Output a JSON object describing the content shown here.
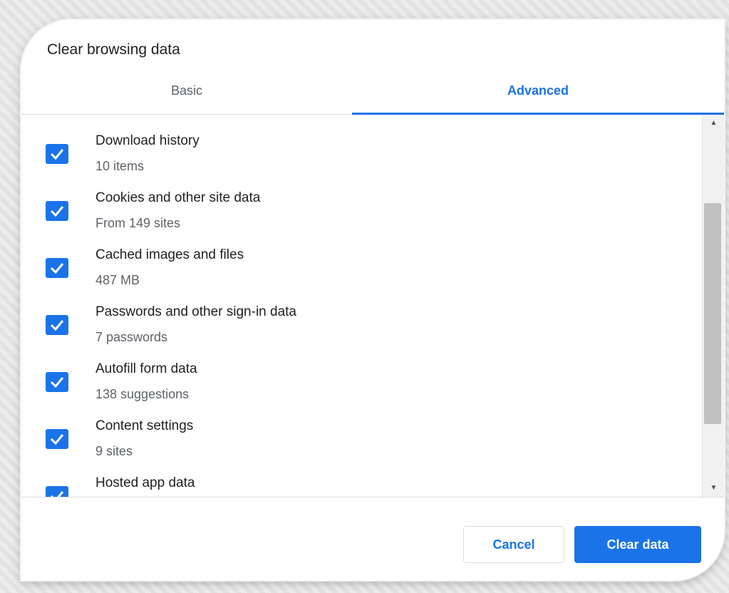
{
  "dialog": {
    "title": "Clear browsing data",
    "tabs": [
      {
        "label": "Basic",
        "selected": false
      },
      {
        "label": "Advanced",
        "selected": true
      }
    ],
    "items": [
      {
        "label": "Download history",
        "detail": "10 items",
        "checked": true
      },
      {
        "label": "Cookies and other site data",
        "detail": "From 149 sites",
        "checked": true
      },
      {
        "label": "Cached images and files",
        "detail": "487 MB",
        "checked": true
      },
      {
        "label": "Passwords and other sign-in data",
        "detail": "7 passwords",
        "checked": true
      },
      {
        "label": "Autofill form data",
        "detail": "138 suggestions",
        "checked": true
      },
      {
        "label": "Content settings",
        "detail": "9 sites",
        "checked": true
      },
      {
        "label": "Hosted app data",
        "detail": "",
        "checked": true
      }
    ],
    "buttons": {
      "cancel_label": "Cancel",
      "clear_label": "Clear data"
    }
  },
  "colors": {
    "accent": "#1a73e8",
    "text_primary": "#202124",
    "text_secondary": "#5f6368",
    "divider": "#dadce0"
  },
  "icons": {
    "checkbox": "check-icon",
    "scroll_up": "arrow-up-icon",
    "scroll_down": "arrow-down-icon"
  }
}
